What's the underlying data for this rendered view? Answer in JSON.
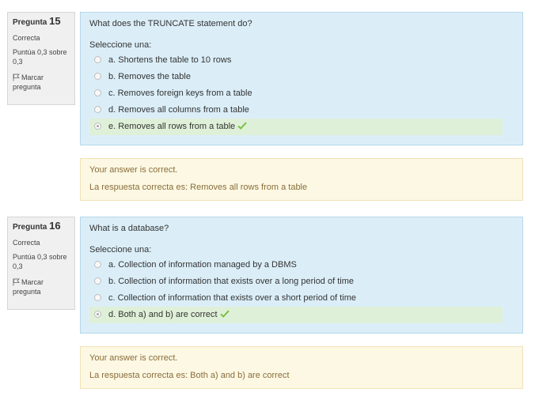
{
  "questions": [
    {
      "label": "Pregunta",
      "number": "15",
      "state": "Correcta",
      "grade": "Puntúa 0,3 sobre 0,3",
      "flag_label": "Marcar pregunta",
      "text": "What does the TRUNCATE statement do?",
      "prompt": "Seleccione una:",
      "options": [
        {
          "label": "a. Shortens the table to 10 rows",
          "selected": false,
          "correct": false
        },
        {
          "label": "b. Removes the table",
          "selected": false,
          "correct": false
        },
        {
          "label": "c. Removes foreign keys from a table",
          "selected": false,
          "correct": false
        },
        {
          "label": "d. Removes all columns from a table",
          "selected": false,
          "correct": false
        },
        {
          "label": "e. Removes all rows from a table",
          "selected": true,
          "correct": true
        }
      ],
      "feedback": "Your answer is correct.",
      "right_answer": "La respuesta correcta es: Removes all rows from a table"
    },
    {
      "label": "Pregunta",
      "number": "16",
      "state": "Correcta",
      "grade": "Puntúa 0,3 sobre 0,3",
      "flag_label": "Marcar pregunta",
      "text": "What is a database?",
      "prompt": "Seleccione una:",
      "options": [
        {
          "label": "a. Collection of information managed by a DBMS",
          "selected": false,
          "correct": false
        },
        {
          "label": "b. Collection of information that exists over a long period of time",
          "selected": false,
          "correct": false
        },
        {
          "label": "c. Collection of information that exists over a short period of time",
          "selected": false,
          "correct": false
        },
        {
          "label": "d. Both a) and b) are correct",
          "selected": true,
          "correct": true
        }
      ],
      "feedback": "Your answer is correct.",
      "right_answer": "La respuesta correcta es: Both a) and b) are correct"
    }
  ],
  "colors": {
    "info_bg": "#f0f0f0",
    "formulation_bg": "#dbeef8",
    "correct_option_bg": "#dff0d8",
    "outcome_bg": "#fcf8e3",
    "outcome_text": "#8a6d3b",
    "tick": "#7ac143"
  },
  "icons": {
    "flag": "flag-icon",
    "correct": "check-icon",
    "radio": "radio-icon"
  }
}
